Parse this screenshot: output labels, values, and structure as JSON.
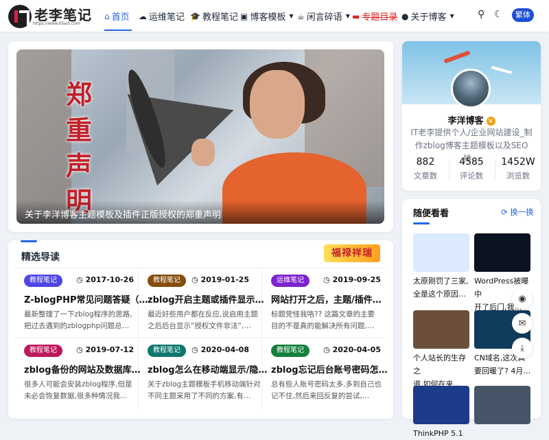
{
  "site": {
    "logo_text": "老李笔记",
    "logo_url": "https://www.itlaoli.com"
  },
  "nav": {
    "items": [
      {
        "label": "首页",
        "icon": "home-icon"
      },
      {
        "label": "运维笔记",
        "icon": "cloud-icon"
      },
      {
        "label": "教程笔记",
        "icon": "graduation-cap-icon"
      },
      {
        "label": "博客模板",
        "icon": "folder-icon"
      },
      {
        "label": "闲言碎语",
        "icon": "coffee-icon"
      },
      {
        "label": "专题目录",
        "icon": "book-icon"
      },
      {
        "label": "关于博客",
        "icon": "user-icon"
      }
    ],
    "traditional_label": "繁体"
  },
  "hero": {
    "title": "郑重声明",
    "caption": "关于李洋博客主题模板及插件正版授权的郑重声明"
  },
  "featured": {
    "title": "精选导读",
    "badge_text": "福禄祥瑞",
    "posts": [
      {
        "tag": "教程笔记",
        "tag_color": "#4f46e5",
        "date": "2017-10-26",
        "title": "Z-blogPHP常见问题答疑（…",
        "excerpt": [
          "最新整理了一下zblog程序的思路,",
          "把过去遇到的zblogphp问题总…"
        ]
      },
      {
        "tag": "教程笔记",
        "tag_color": "#854d0e",
        "date": "2019-01-25",
        "title": "zblog开启主题或插件显示…",
        "excerpt": [
          "最近好些用户都在反应,说启用主题",
          "之后后台显示“授权文件非法”,…"
        ]
      },
      {
        "tag": "运维笔记",
        "tag_color": "#7e22ce",
        "date": "2019-09-25",
        "title": "网站打开之后，主题/插件…",
        "excerpt": [
          "标题党怪我咯?? 这篇文章的主要",
          "目的不是真的能解决所有问题,…"
        ]
      },
      {
        "tag": "教程笔记",
        "tag_color": "#be185d",
        "date": "2019-07-12",
        "title": "zblog备份的网站及数据库…",
        "excerpt": [
          "很多人可能会安装zblog程序,但是",
          "未必会恢复数据,很多种情况我…"
        ]
      },
      {
        "tag": "教程笔记",
        "tag_color": "#0f766e",
        "date": "2020-04-08",
        "title": "zblog怎么在移动端显示/隐…",
        "excerpt": [
          "关于zblog主题模板手机移动端针对",
          "不同主题采用了不同的方案,有…"
        ]
      },
      {
        "tag": "教程笔记",
        "tag_color": "#15803d",
        "date": "2020-04-05",
        "title": "zblog忘记后台账号密码怎…",
        "excerpt": [
          "总有些人账号密码太多,多到自己也",
          "记不住,然后来回反复的尝试,…"
        ]
      }
    ]
  },
  "profile": {
    "name": "李洋博客",
    "verified_badge": "V",
    "desc": [
      "IT老李提供个人/企业网站建设_制",
      "作zblog博客主题模板以及SEO排…"
    ],
    "stats": [
      {
        "value": "882",
        "label": "文章数"
      },
      {
        "value": "4585",
        "label": "评论数"
      },
      {
        "value": "1452W",
        "label": "浏览数"
      }
    ]
  },
  "random": {
    "title": "随便看看",
    "refresh_label": "换一换",
    "items": [
      {
        "caption": [
          "太原刚罚了三家,",
          "全是这个原因…"
        ],
        "thumb_color": "#dbeafe"
      },
      {
        "caption": [
          "WordPress被曝中",
          "开了后门,我…"
        ],
        "thumb_color": "#0b1220"
      },
      {
        "caption": [
          "个人站长的生存之",
          "道,如何在夹…"
        ],
        "thumb_color": "#6b4f3a"
      },
      {
        "caption": [
          "CN域名,这次真",
          "要回暖了? 4月…"
        ],
        "thumb_color": "#0f3b5c"
      },
      {
        "caption": [
          "ThinkPHP 5.1",
          ""
        ],
        "thumb_color": "#1e3a8a"
      },
      {
        "caption": [
          "",
          ""
        ],
        "thumb_color": "#475569"
      }
    ]
  },
  "colors": {
    "accent": "#2563eb",
    "hero_title": "#c2212b"
  }
}
